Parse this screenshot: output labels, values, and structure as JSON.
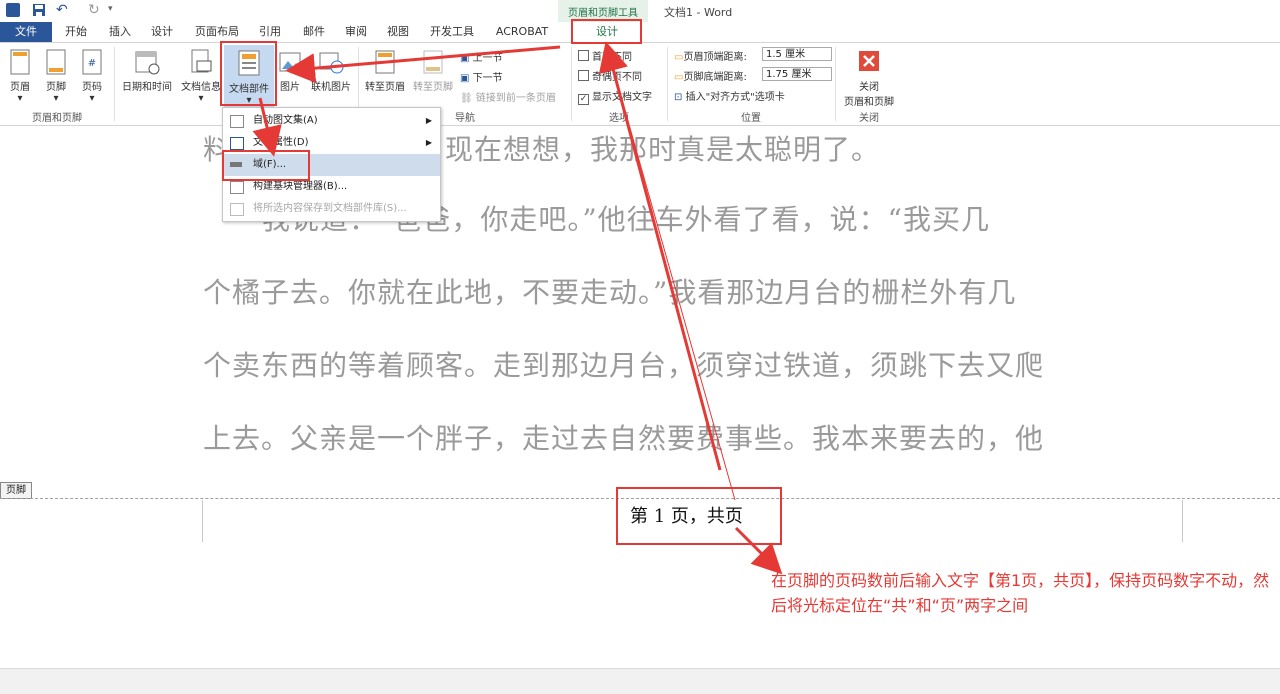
{
  "window": {
    "title": "文档1 - Word",
    "contextual_group": "页眉和页脚工具"
  },
  "tabs": [
    "文件",
    "开始",
    "插入",
    "设计",
    "页面布局",
    "引用",
    "邮件",
    "审阅",
    "视图",
    "开发工具",
    "ACROBAT",
    "设计"
  ],
  "ribbon": {
    "header_footer": {
      "buttons": [
        "页眉",
        "页脚",
        "页码"
      ],
      "label": "页眉和页脚"
    },
    "insert": {
      "buttons": [
        "日期和时间",
        "文档信息",
        "文档部件",
        "图片",
        "联机图片"
      ]
    },
    "nav": {
      "goto_header": "转至页眉",
      "goto_footer": "转至页脚",
      "prev": "上一节",
      "next": "下一节",
      "link_prev": "链接到前一条页眉",
      "label": "导航"
    },
    "options": {
      "first_diff": "首页不同",
      "odd_even": "奇偶页不同",
      "show_text": "显示文档文字",
      "label": "选项"
    },
    "position": {
      "header_dist_label": "页眉顶端距离:",
      "header_dist": "1.5 厘米",
      "footer_dist_label": "页脚底端距离:",
      "footer_dist": "1.75 厘米",
      "insert_align": "插入\"对齐方式\"选项卡",
      "label": "位置"
    },
    "close": {
      "button_line1": "关闭",
      "button_line2": "页眉和页脚",
      "label": "关闭"
    }
  },
  "menu": {
    "items": [
      {
        "label": "自动图文集(A)",
        "submenu": true
      },
      {
        "label": "文档属性(D)",
        "submenu": true
      },
      {
        "label": "域(F)..."
      },
      {
        "label": "构建基块管理器(B)..."
      },
      {
        "label": "将所选内容保存到文档部件库(S)...",
        "disabled": true
      }
    ]
  },
  "document": {
    "lines": [
      "料",
      "现在想想，我那时真是太聪明了。",
      "我说道：“爸爸，你走吧。”他往车外看了看，说：“我买几",
      "个橘子去。你就在此地，不要走动。”我看那边月台的栅栏外有几",
      "个卖东西的等着顾客。走到那边月台，须穿过铁道，须跳下去又爬",
      "上去。父亲是一个胖子，走过去自然要费事些。我本来要去的，他"
    ],
    "footer_tag": "页脚",
    "footer_text": "第 1 页，共页"
  },
  "annotation": {
    "note": "在页脚的页码数前后输入文字【第1页，共页】，保持页码数字不动，然后将光标定位在“共”和“页”两字之间"
  },
  "colors": {
    "file_tab": "#2b579a",
    "annotation": "#e53935",
    "contextual": "#217346",
    "menu_highlight": "#cfdcec"
  }
}
